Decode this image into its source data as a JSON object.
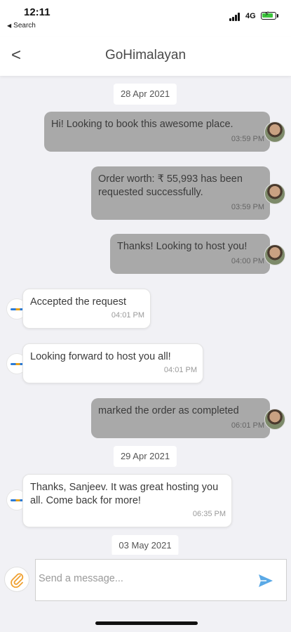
{
  "status_bar": {
    "time": "12:11",
    "back_label": "Search",
    "network": "4G"
  },
  "header": {
    "title": "GoHimalayan"
  },
  "colors": {
    "outgoing_bubble": "#a9a9a9",
    "incoming_bubble": "#ffffff",
    "background": "#f1f1f5",
    "attach_icon": "#f0a030",
    "send_icon": "#5aa9e6"
  },
  "dates": [
    "28 Apr 2021",
    "29 Apr 2021",
    "03 May 2021"
  ],
  "messages": [
    {
      "sender": "user",
      "text": "Hi! Looking to book this awesome place.",
      "time": "03:59 PM"
    },
    {
      "sender": "user",
      "text": "Order worth: ₹ 55,993 has been requested successfully.",
      "time": "03:59 PM"
    },
    {
      "sender": "user",
      "text": "Thanks! Looking to host you!",
      "time": "04:00 PM"
    },
    {
      "sender": "host",
      "text": "Accepted the request",
      "time": "04:01 PM"
    },
    {
      "sender": "host",
      "text": "Looking forward to host you all!",
      "time": "04:01 PM"
    },
    {
      "sender": "user",
      "text": "marked the order as completed",
      "time": "06:01 PM"
    },
    {
      "sender": "host",
      "text": "Thanks, Sanjeev. It was great hosting you all. Come back for more!",
      "time": "06:35 PM"
    }
  ],
  "composer": {
    "placeholder": "Send a message..."
  }
}
